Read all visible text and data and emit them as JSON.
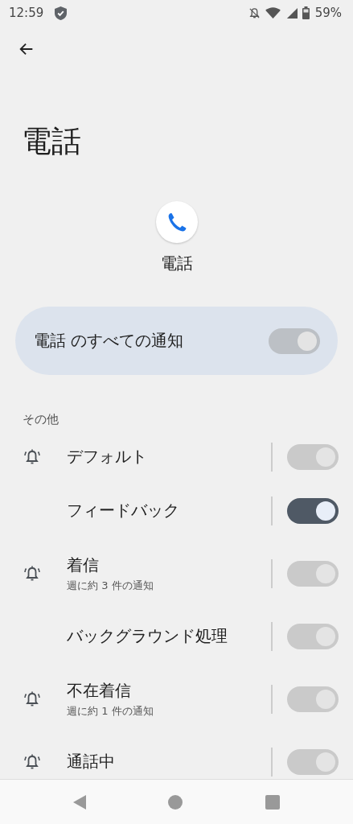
{
  "status_bar": {
    "time": "12:59",
    "battery": "59%"
  },
  "page": {
    "title": "電話"
  },
  "app": {
    "name": "電話"
  },
  "master": {
    "label": "電話 のすべての通知",
    "on": true,
    "disabled": true
  },
  "section": {
    "title": "その他"
  },
  "channels": [
    {
      "name": "デフォルト",
      "bell": true,
      "on": true,
      "disabled": true
    },
    {
      "name": "フィードバック",
      "bell": false,
      "on": true,
      "disabled": false
    },
    {
      "name": "着信",
      "summary": "週に約 3 件の通知",
      "bell": true,
      "on": true,
      "disabled": true
    },
    {
      "name": "バックグラウンド処理",
      "bell": false,
      "on": true,
      "disabled": true
    },
    {
      "name": "不在着信",
      "summary": "週に約 1 件の通知",
      "bell": true,
      "on": true,
      "disabled": true
    },
    {
      "name": "通話中",
      "bell": true,
      "on": true,
      "disabled": true
    }
  ]
}
